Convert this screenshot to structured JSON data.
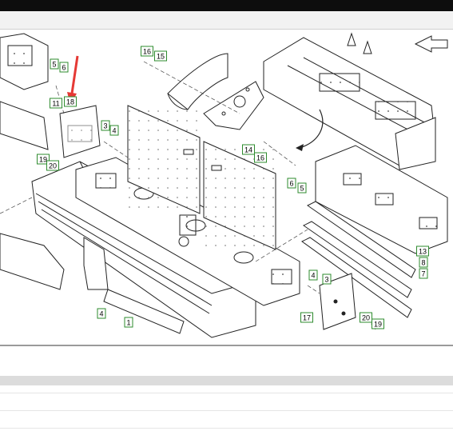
{
  "callouts": [
    {
      "id": "c5a",
      "text": "5"
    },
    {
      "id": "c6a",
      "text": "6"
    },
    {
      "id": "c11",
      "text": "11"
    },
    {
      "id": "c18",
      "text": "18"
    },
    {
      "id": "c16a",
      "text": "16"
    },
    {
      "id": "c15",
      "text": "15"
    },
    {
      "id": "c3a",
      "text": "3"
    },
    {
      "id": "c4a",
      "text": "4"
    },
    {
      "id": "c19a",
      "text": "19"
    },
    {
      "id": "c20a",
      "text": "20"
    },
    {
      "id": "c14",
      "text": "14"
    },
    {
      "id": "c16b",
      "text": "16"
    },
    {
      "id": "c6b",
      "text": "6"
    },
    {
      "id": "c5b",
      "text": "5"
    },
    {
      "id": "c13",
      "text": "13"
    },
    {
      "id": "c8",
      "text": "8"
    },
    {
      "id": "c7",
      "text": "7"
    },
    {
      "id": "c4b",
      "text": "4"
    },
    {
      "id": "c3b",
      "text": "3"
    },
    {
      "id": "c4c",
      "text": "4"
    },
    {
      "id": "c1",
      "text": "1"
    },
    {
      "id": "c17",
      "text": "17"
    },
    {
      "id": "c20b",
      "text": "20"
    },
    {
      "id": "c19b",
      "text": "19"
    }
  ],
  "colors": {
    "callout_border": "#2e8b2e",
    "pointer_arrow": "#e53935",
    "line_art": "#222222"
  }
}
